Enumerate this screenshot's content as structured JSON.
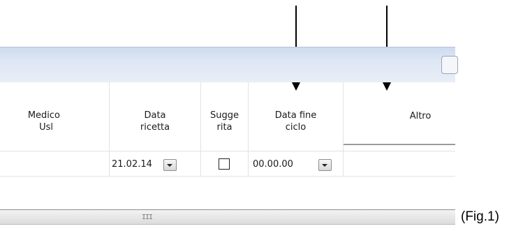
{
  "grid": {
    "columns": [
      {
        "key": "medico_usl",
        "label_lines": [
          "Medico",
          "Usl"
        ]
      },
      {
        "key": "data_ricetta",
        "label_lines": [
          "Data",
          "ricetta"
        ]
      },
      {
        "key": "suggerita",
        "label_lines": [
          "Sugge",
          "rita"
        ]
      },
      {
        "key": "data_fine_ciclo",
        "label_lines": [
          "Data fine",
          "ciclo"
        ]
      },
      {
        "key": "altro",
        "label_lines": [
          "Altro"
        ]
      }
    ],
    "row": {
      "data_ricetta": "21.02.14",
      "suggerita_checked": false,
      "data_fine_ciclo": "00.00.00"
    }
  },
  "scrollbar": {
    "grip": "III"
  },
  "caption": "(Fig.1)"
}
